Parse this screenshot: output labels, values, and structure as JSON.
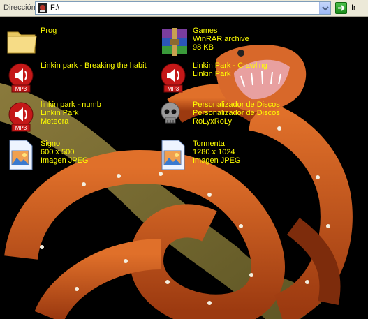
{
  "address_bar": {
    "label": "Dirección",
    "path": "F:\\",
    "go_label": "Ir"
  },
  "items": [
    {
      "name": "Prog",
      "detail1": "",
      "detail2": "",
      "icon": "folder-icon"
    },
    {
      "name": "Games",
      "detail1": "WinRAR archive",
      "detail2": "98 KB",
      "icon": "winrar-icon"
    },
    {
      "name": "Linkin park - Breaking the habit",
      "detail1": "",
      "detail2": "",
      "icon": "mp3-icon"
    },
    {
      "name": "Linkin Park - Crawling",
      "detail1": "Linkin Park",
      "detail2": "",
      "icon": "mp3-icon"
    },
    {
      "name": "linkin park - numb",
      "detail1": "Linkin Park",
      "detail2": "Meteora",
      "icon": "mp3-icon"
    },
    {
      "name": "Personalizador de Discos",
      "detail1": "Personalizador de Discos",
      "detail2": "RoLyxRoLy",
      "icon": "skull-icon"
    },
    {
      "name": "Signo",
      "detail1": "600 x 500",
      "detail2": "Imagen JPEG",
      "icon": "jpeg-image-icon"
    },
    {
      "name": "Tormenta",
      "detail1": "1280 x 1024",
      "detail2": "Imagen JPEG",
      "icon": "jpeg-image-icon"
    }
  ],
  "colors": {
    "label_text": "#ffff00",
    "background": "#000000",
    "snake_orange": "#c8561a"
  }
}
